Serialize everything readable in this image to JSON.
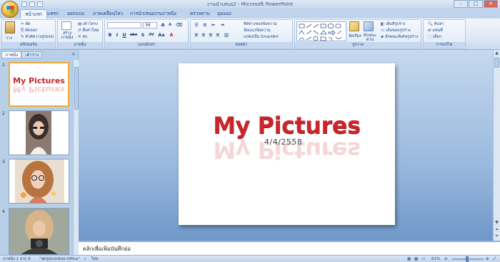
{
  "window": {
    "title": "งานนำเสนอ2 - Microsoft PowerPoint",
    "controls": {
      "minimize": "–",
      "maximize": "□",
      "close": "×"
    }
  },
  "ribbon_tabs": [
    "หน้าแรก",
    "แทรก",
    "ออกแบบ",
    "ภาพเคลื่อนไหว",
    "การนำเสนองานภาพนิ่ง",
    "ตรวจทาน",
    "มุมมอง"
  ],
  "ribbon": {
    "clipboard": {
      "label": "คลิปบอร์ด",
      "paste": "วาง",
      "cut": "ตัด",
      "copy": "คัดลอก",
      "format_painter": "ตัวคัดวางรูปแบบ"
    },
    "slides": {
      "label": "ภาพนิ่ง",
      "new_slide": "สร้างภาพนิ่ง",
      "layout": "เค้าโครง",
      "reset": "ตั้งค่าใหม่",
      "delete": "ลบ"
    },
    "font": {
      "label": "แบบอักษร",
      "font_name": "",
      "font_size": "36",
      "bold": "B",
      "italic": "I",
      "underline": "U",
      "strike": "abe",
      "shadow": "S",
      "spacing": "AV",
      "case": "Aa",
      "grow": "A",
      "shrink": "A"
    },
    "paragraph": {
      "label": "ย่อหน้า",
      "text_direction": "ทิศทางของข้อความ",
      "align_text": "จัดแนวข้อความ",
      "smartart": "แปลงเป็น SmartArt"
    },
    "drawing": {
      "label": "รูปวาด",
      "arrange": "จัดเรียง",
      "quick_styles": "ลักษณะด่วน",
      "shape_fill": "เติมสีรูปร่าง",
      "shape_outline": "เส้นขอบรูปร่าง",
      "shape_effects": "ลักษณะพิเศษรูปร่าง"
    },
    "editing": {
      "label": "การแก้ไข",
      "find": "ค้นหา",
      "replace": "แทนที่",
      "select": "เลือก"
    }
  },
  "slide_panel": {
    "tabs": [
      "ภาพนิ่ง",
      "เค้าร่าง"
    ],
    "close": "×",
    "thumb_title": "My Pictures",
    "thumbs": [
      {
        "num": "1",
        "type": "title"
      },
      {
        "num": "2",
        "type": "photo"
      },
      {
        "num": "3",
        "type": "photo"
      },
      {
        "num": "4",
        "type": "photo"
      }
    ]
  },
  "slide": {
    "title": "My Pictures",
    "date": "4/4/2558"
  },
  "notes_placeholder": "คลิกเพื่อเพิ่มบันทึกย่อ",
  "status": {
    "slide_info": "ภาพนิ่ง 1 จาก 9",
    "theme": "\"ชุดรูปแบบของ Office\"",
    "language": "ไทย",
    "zoom": "61%"
  },
  "colors": {
    "title_red": "#c8262c",
    "ribbon_blue": "#bfd3ec",
    "selected_orange": "#f2a93b"
  }
}
